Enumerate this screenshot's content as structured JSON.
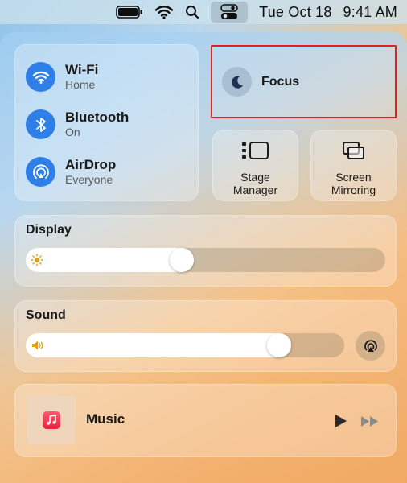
{
  "menubar": {
    "date": "Tue Oct 18",
    "time": "9:41 AM",
    "icons": [
      "battery-icon",
      "wifi-icon",
      "search-icon",
      "control-center-icon"
    ]
  },
  "connectivity": {
    "wifi": {
      "title": "Wi-Fi",
      "subtitle": "Home",
      "icon": "wifi-icon"
    },
    "bluetooth": {
      "title": "Bluetooth",
      "subtitle": "On",
      "icon": "bluetooth-icon"
    },
    "airdrop": {
      "title": "AirDrop",
      "subtitle": "Everyone",
      "icon": "airdrop-icon"
    },
    "accent": "#2f7fe8"
  },
  "focus": {
    "label": "Focus",
    "icon": "moon-icon",
    "highlight": "#e02020"
  },
  "stage_manager": {
    "line1": "Stage",
    "line2": "Manager",
    "icon": "stage-manager-icon"
  },
  "screen_mirroring": {
    "line1": "Screen",
    "line2": "Mirroring",
    "icon": "screen-mirroring-icon"
  },
  "display": {
    "title": "Display",
    "level": 0.43,
    "icon": "brightness-icon"
  },
  "sound": {
    "title": "Sound",
    "level": 0.82,
    "icon": "speaker-icon",
    "output_icon": "airplay-icon"
  },
  "music": {
    "label": "Music",
    "app_icon": "music-app-icon",
    "controls": [
      "play-icon",
      "fast-forward-icon"
    ]
  }
}
